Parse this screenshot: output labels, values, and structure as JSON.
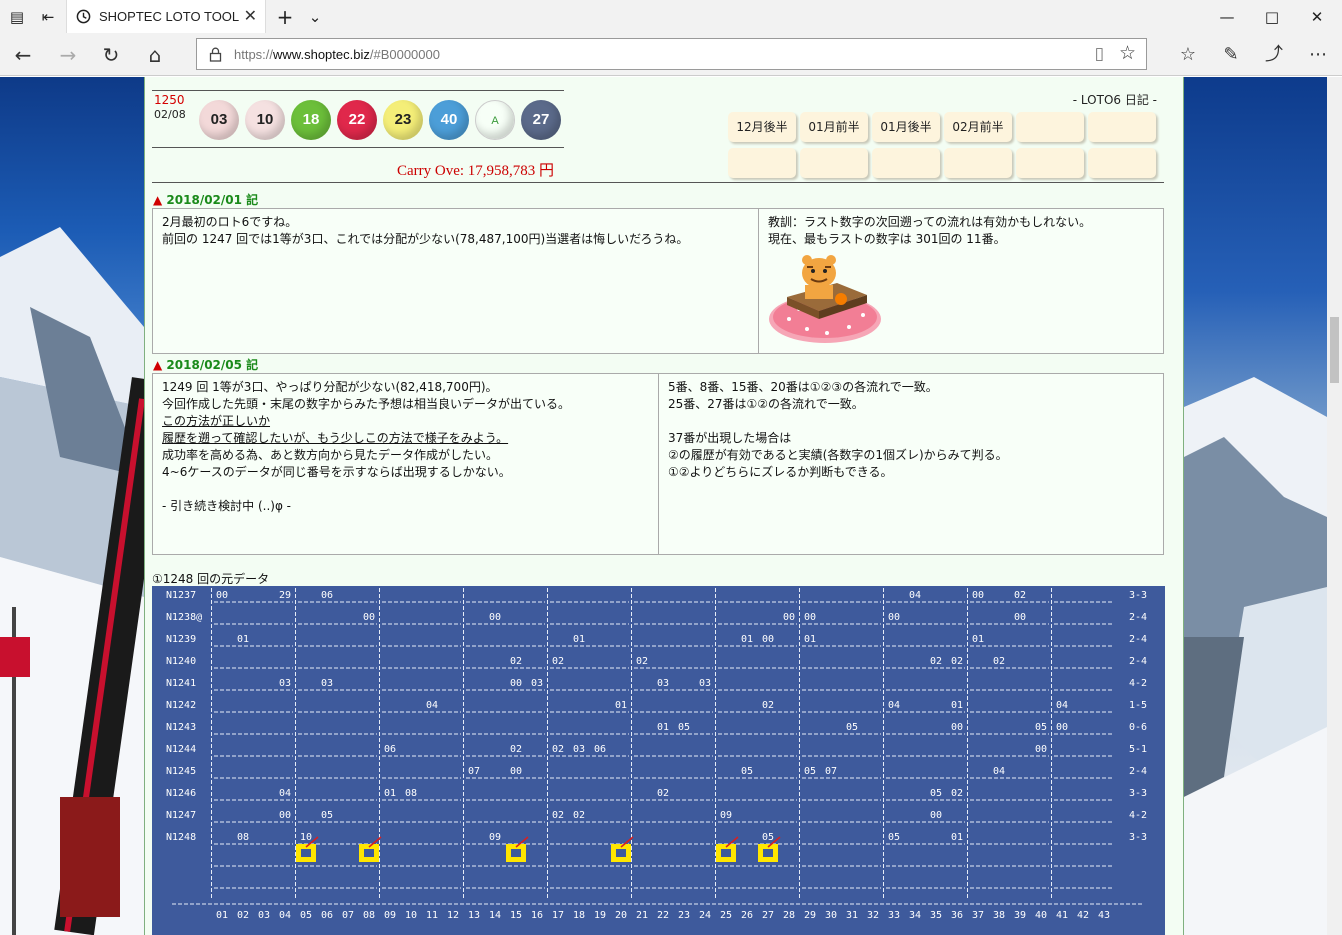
{
  "browser": {
    "tab_title": "SHOPTEC LOTO TOOL",
    "url_scheme": "https://",
    "url_host": "www.shoptec.biz",
    "url_path": "/#B0000000"
  },
  "header": {
    "draw_number": "1250",
    "draw_date": "02/08",
    "balls": [
      {
        "value": "03",
        "color": "#f3d9d9",
        "text": "#222"
      },
      {
        "value": "10",
        "color": "#f5e1e1",
        "text": "#222"
      },
      {
        "value": "18",
        "color": "#6cbf3a",
        "text": "#fff"
      },
      {
        "value": "22",
        "color": "#e0284b",
        "text": "#fff"
      },
      {
        "value": "23",
        "color": "#f4ee78",
        "text": "#222"
      },
      {
        "value": "40",
        "color": "#4c9ed8",
        "text": "#fff"
      },
      {
        "value": "A",
        "color": "#f7fff7",
        "text": "#3a9a3a"
      },
      {
        "value": "27",
        "color": "#5b6a8a",
        "text": "#fff"
      }
    ],
    "carry_over": "Carry Ove: 17,958,783 円",
    "diary_title": "- LOTO6 日記 -",
    "month_buttons": [
      "12月後半",
      "01月前半",
      "01月後半",
      "02月前半",
      "",
      "",
      "",
      "",
      "",
      "",
      "",
      ""
    ]
  },
  "entries": [
    {
      "date": "2018/02/01 記",
      "left_text": "2月最初のロト6ですね。\n前回の 1247 回では1等が3口、これでは分配が少ない(78,487,100円)当選者は悔しいだろうね。",
      "right_text": "教訓：ラスト数字の次回遡っての流れは有効かもしれない。\n現在、最もラストの数字は 301回の 11番。"
    },
    {
      "date": "2018/02/05 記",
      "left_text_1": "1249 回 1等が3口、やっぱり分配が少ない(82,418,700円)。\n今回作成した先頭・末尾の数字からみた予想は相当良いデータが出ている。",
      "left_underline": "この方法が正しいか\n履歴を遡って確認したいが、もう少しこの方法で様子をみよう。",
      "left_text_2": "成功率を高める為、あと数方向から見たデータ作成がしたい。\n4~6ケースのデータが同じ番号を示すならば出現するしかない。\n\n- 引き続き検討中 (..)φ -",
      "right_text": "5番、8番、15番、20番は①②③の各流れで一致。\n25番、27番は①②の各流れで一致。\n\n37番が出現した場合は\n②の履歴が有効であると実績(各数字の1個ズレ)からみて判る。\n①②よりどちらにズレるか判断もできる。"
    }
  ],
  "grid": {
    "title": "①1248 回の元データ",
    "rows": [
      {
        "label": "N1237",
        "right": "3-3",
        "cells": [
          [
            "00",
            1
          ],
          [
            "29",
            4
          ],
          [
            "06",
            6
          ],
          [
            "04",
            34
          ],
          [
            "00",
            37
          ],
          [
            "02",
            39
          ]
        ]
      },
      {
        "label": "N1238@",
        "right": "2-4",
        "cells": [
          [
            "00",
            8
          ],
          [
            "00",
            14
          ],
          [
            "00",
            28
          ],
          [
            "00",
            29
          ],
          [
            "00",
            33
          ],
          [
            "00",
            39
          ]
        ]
      },
      {
        "label": "N1239",
        "right": "2-4",
        "cells": [
          [
            "01",
            2
          ],
          [
            "01",
            18
          ],
          [
            "01",
            26
          ],
          [
            "00",
            27
          ],
          [
            "01",
            29
          ],
          [
            "01",
            37
          ]
        ]
      },
      {
        "label": "N1240",
        "right": "2-4",
        "cells": [
          [
            "02",
            15
          ],
          [
            "02",
            17
          ],
          [
            "02",
            21
          ],
          [
            "02",
            35
          ],
          [
            "02",
            36
          ],
          [
            "02",
            38
          ]
        ]
      },
      {
        "label": "N1241",
        "right": "4-2",
        "cells": [
          [
            "03",
            4
          ],
          [
            "03",
            6
          ],
          [
            "00",
            15
          ],
          [
            "03",
            16
          ],
          [
            "03",
            22
          ],
          [
            "03",
            24
          ]
        ]
      },
      {
        "label": "N1242",
        "right": "1-5",
        "cells": [
          [
            "04",
            11
          ],
          [
            "01",
            20
          ],
          [
            "02",
            27
          ],
          [
            "04",
            33
          ],
          [
            "01",
            36
          ],
          [
            "04",
            41
          ]
        ]
      },
      {
        "label": "N1243",
        "right": "0-6",
        "cells": [
          [
            "01",
            22
          ],
          [
            "05",
            23
          ],
          [
            "05",
            31
          ],
          [
            "00",
            36
          ],
          [
            "05",
            40
          ],
          [
            "00",
            41
          ]
        ]
      },
      {
        "label": "N1244",
        "right": "5-1",
        "cells": [
          [
            "06",
            9
          ],
          [
            "02",
            15
          ],
          [
            "02",
            17
          ],
          [
            "03",
            18
          ],
          [
            "06",
            19
          ],
          [
            "00",
            40
          ]
        ]
      },
      {
        "label": "N1245",
        "right": "2-4",
        "cells": [
          [
            "07",
            13
          ],
          [
            "00",
            15
          ],
          [
            "05",
            26
          ],
          [
            "05",
            29
          ],
          [
            "07",
            30
          ],
          [
            "04",
            38
          ]
        ]
      },
      {
        "label": "N1246",
        "right": "3-3",
        "cells": [
          [
            "04",
            4
          ],
          [
            "01",
            9
          ],
          [
            "08",
            10
          ],
          [
            "02",
            22
          ],
          [
            "05",
            35
          ],
          [
            "02",
            36
          ]
        ]
      },
      {
        "label": "N1247",
        "right": "4-2",
        "cells": [
          [
            "00",
            4
          ],
          [
            "05",
            6
          ],
          [
            "02",
            17
          ],
          [
            "02",
            18
          ],
          [
            "09",
            25
          ],
          [
            "00",
            35
          ]
        ]
      },
      {
        "label": "N1248",
        "right": "3-3",
        "cells": [
          [
            "08",
            2
          ],
          [
            "10",
            5
          ],
          [
            "09",
            14
          ],
          [
            "05",
            27
          ],
          [
            "05",
            33
          ],
          [
            "01",
            36
          ]
        ]
      }
    ],
    "highlights": [
      5,
      8,
      15,
      20,
      25,
      27
    ],
    "columns": [
      "01",
      "02",
      "03",
      "04",
      "05",
      "06",
      "07",
      "08",
      "09",
      "10",
      "11",
      "12",
      "13",
      "14",
      "15",
      "16",
      "17",
      "18",
      "19",
      "20",
      "21",
      "22",
      "23",
      "24",
      "25",
      "26",
      "27",
      "28",
      "29",
      "30",
      "31",
      "32",
      "33",
      "34",
      "35",
      "36",
      "37",
      "38",
      "39",
      "40",
      "41",
      "42",
      "43"
    ]
  }
}
